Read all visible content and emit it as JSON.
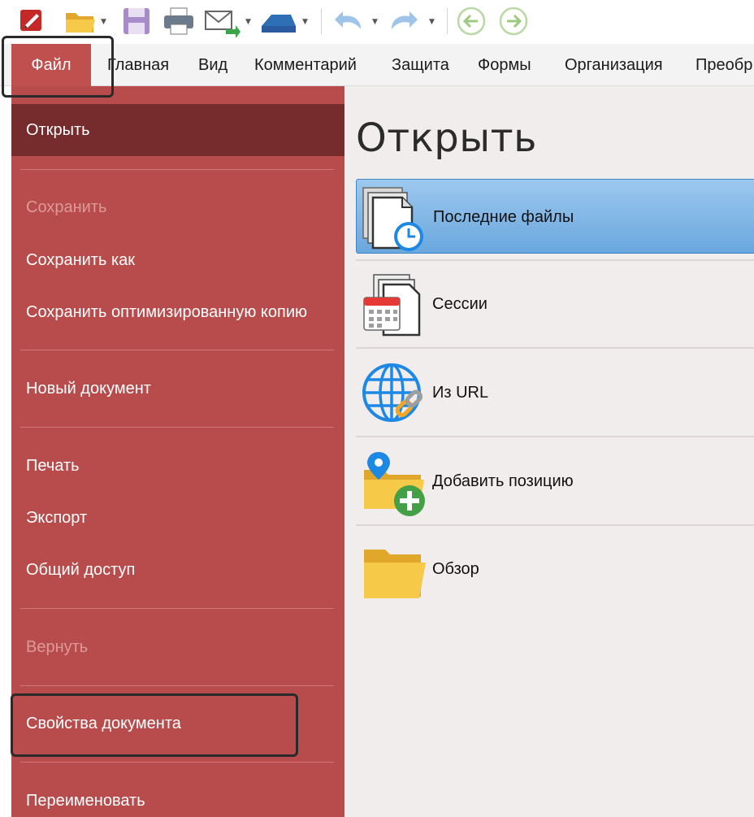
{
  "ribbon": {
    "file_tab": "Файл",
    "tabs": [
      "Главная",
      "Вид",
      "Комментарий",
      "Защита",
      "Формы",
      "Организация",
      "Преобр"
    ]
  },
  "sidebar": {
    "items": [
      {
        "label": "Открыть",
        "state": "selected"
      },
      {
        "label": "Сохранить",
        "state": "disabled"
      },
      {
        "label": "Сохранить как",
        "state": "normal"
      },
      {
        "label": "Сохранить оптимизированную копию",
        "state": "normal"
      },
      {
        "label": "Новый документ",
        "state": "normal"
      },
      {
        "label": "Печать",
        "state": "normal"
      },
      {
        "label": "Экспорт",
        "state": "normal"
      },
      {
        "label": "Общий доступ",
        "state": "normal"
      },
      {
        "label": "Вернуть",
        "state": "disabled"
      },
      {
        "label": "Свойства документа",
        "state": "normal"
      },
      {
        "label": "Переименовать",
        "state": "normal"
      }
    ]
  },
  "main": {
    "title": "Открыть",
    "options": [
      {
        "label": "Последние файлы",
        "icon": "recent-files-icon",
        "selected": true
      },
      {
        "label": "Сессии",
        "icon": "sessions-icon",
        "selected": false
      },
      {
        "label": "Из URL",
        "icon": "globe-link-icon",
        "selected": false
      },
      {
        "label": "Добавить позицию",
        "icon": "add-place-icon",
        "selected": false
      },
      {
        "label": "Обзор",
        "icon": "folder-icon",
        "selected": false
      }
    ]
  },
  "colors": {
    "file_accent": "#c0504d",
    "sidebar_bg": "#b84c4c",
    "sidebar_selected": "#762c2c",
    "main_bg": "#f2eded",
    "selected_option": "#6aa7de"
  }
}
